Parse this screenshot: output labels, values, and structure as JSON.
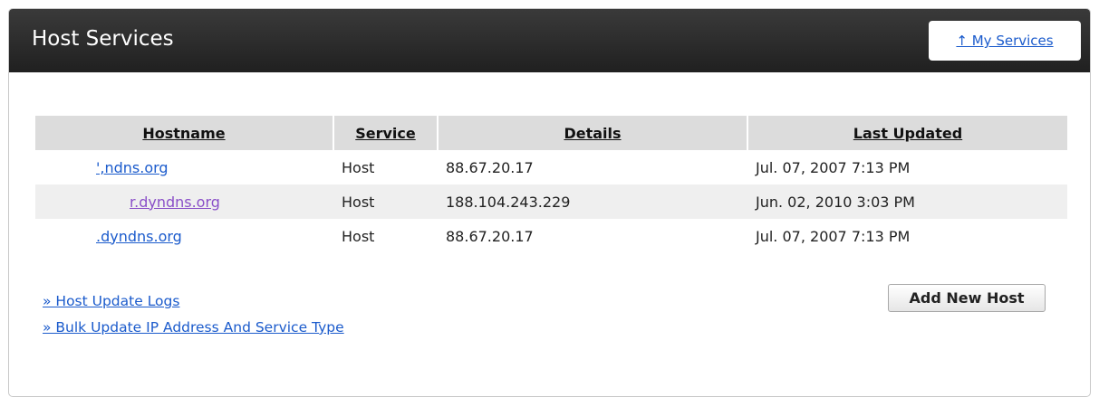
{
  "header": {
    "title": "Host Services",
    "my_services_link": "↑ My Services"
  },
  "table": {
    "columns": [
      "Hostname",
      "Service",
      "Details",
      "Last Updated"
    ],
    "rows": [
      {
        "hostname": "',ndns.org",
        "service": "Host",
        "details": "88.67.20.17",
        "last_updated": "Jul. 07, 2007 7:13 PM"
      },
      {
        "hostname": "r.dyndns.org",
        "service": "Host",
        "details": "188.104.243.229",
        "last_updated": "Jun. 02, 2010 3:03 PM"
      },
      {
        "hostname": ".dyndns.org",
        "service": "Host",
        "details": "88.67.20.17",
        "last_updated": "Jul. 07, 2007 7:13 PM"
      }
    ]
  },
  "footer": {
    "host_update_logs": "» Host Update Logs",
    "bulk_update": "» Bulk Update IP Address And Service Type",
    "add_new_host": "Add New Host"
  },
  "colors": {
    "header_bg": "#2b2b2b",
    "link": "#1b5bcc",
    "visited_link": "#8a4fc8",
    "table_header_bg": "#dcdcdc",
    "alt_row_bg": "#efefef"
  }
}
